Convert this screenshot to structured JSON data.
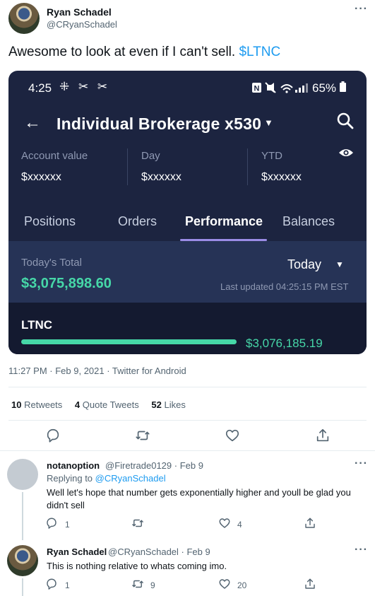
{
  "tweet": {
    "author_name": "Ryan Schadel",
    "author_handle": "@CRyanSchadel",
    "text": "Awesome to look at even if I can't sell.",
    "cashtag": "$LTNC",
    "meta": "11:27 PM · Feb 9, 2021 · Twitter for Android",
    "stats": {
      "retweets_count": "10",
      "retweets_label": "Retweets",
      "quotes_count": "4",
      "quotes_label": "Quote Tweets",
      "likes_count": "52",
      "likes_label": "Likes"
    }
  },
  "screenshot": {
    "status_time": "4:25",
    "status_icons_left": "⁜ ✂ ✂",
    "battery": "65%",
    "account_title": "Individual Brokerage x530",
    "metrics": [
      {
        "label": "Account value",
        "value": "$xxxxxx"
      },
      {
        "label": "Day",
        "value": "$xxxxxx"
      },
      {
        "label": "YTD",
        "value": "$xxxxxx"
      }
    ],
    "tabs": [
      "Positions",
      "Orders",
      "Performance",
      "Balances"
    ],
    "active_tab": "Performance",
    "total_label": "Today's Total",
    "total_value": "$3,075,898.60",
    "period": "Today",
    "last_updated": "Last updated 04:25:15 PM EST",
    "position_symbol": "LTNC",
    "position_value": "$3,076,185.19"
  },
  "replies": [
    {
      "name": "notanoption",
      "handle": "@Firetrade0129 · Feb 9",
      "replying_prefix": "Replying to",
      "replying_to": "@CRyanSchadel",
      "text": "Well let's hope that number gets exponentially higher and youll be glad you didn't sell",
      "reply_count": "1",
      "retweet_count": "",
      "like_count": "4"
    },
    {
      "name": "Ryan Schadel",
      "handle": "@CRyanSchadel · Feb 9",
      "text": "This is nothing relative to whats coming imo.",
      "reply_count": "1",
      "retweet_count": "9",
      "like_count": "20"
    }
  ],
  "icons": {
    "more": "more-dots-icon",
    "reply": "reply-icon",
    "retweet": "retweet-icon",
    "like": "heart-icon",
    "share": "share-icon"
  },
  "colors": {
    "link": "#1d9bf0",
    "gain": "#46d7a8",
    "app_bg": "#1c2440",
    "tab_accent": "#9b8ce6"
  }
}
